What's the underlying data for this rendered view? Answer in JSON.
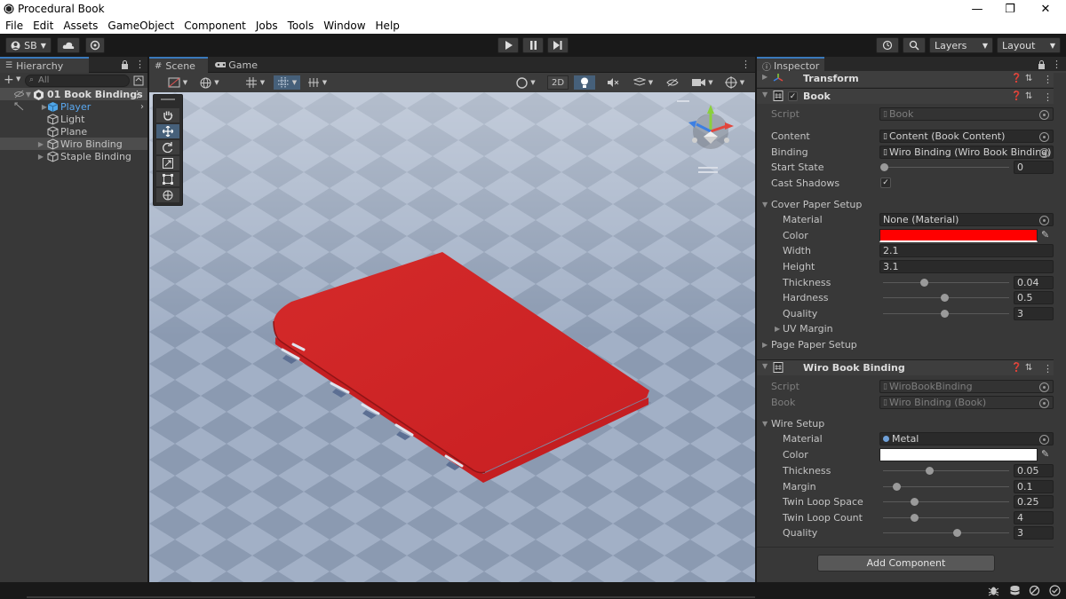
{
  "window": {
    "title": "Procedural Book",
    "min": "—",
    "max": "❐",
    "close": "✕"
  },
  "menu": [
    "File",
    "Edit",
    "Assets",
    "GameObject",
    "Component",
    "Jobs",
    "Tools",
    "Window",
    "Help"
  ],
  "toolbar": {
    "account": "SB",
    "layers": "Layers",
    "layout": "Layout",
    "mode_2d": "2D"
  },
  "hierarchy": {
    "tab": "Hierarchy",
    "search_placeholder": "All",
    "scene": "01 Book Bindings",
    "items": [
      "Player",
      "Light",
      "Plane",
      "Wiro Binding",
      "Staple Binding"
    ]
  },
  "scene": {
    "tab_scene": "Scene",
    "tab_game": "Game"
  },
  "inspector": {
    "tab": "Inspector",
    "transform": "Transform",
    "book": {
      "header": "Book",
      "script_label": "Script",
      "script_value": "Book",
      "content_label": "Content",
      "content_value": "Content (Book Content)",
      "binding_label": "Binding",
      "binding_value": "Wiro Binding (Wiro Book Binding)",
      "start_state_label": "Start State",
      "start_state_value": "0",
      "cast_shadows_label": "Cast Shadows",
      "cover_setup": "Cover Paper Setup",
      "material_label": "Material",
      "material_value": "None (Material)",
      "color_label": "Color",
      "color_value": "#ff0000",
      "width_label": "Width",
      "width_value": "2.1",
      "height_label": "Height",
      "height_value": "3.1",
      "thickness_label": "Thickness",
      "thickness_value": "0.04",
      "hardness_label": "Hardness",
      "hardness_value": "0.5",
      "quality_label": "Quality",
      "quality_value": "3",
      "uv_margin": "UV Margin",
      "page_setup": "Page Paper Setup"
    },
    "wiro": {
      "header": "Wiro Book Binding",
      "script_label": "Script",
      "script_value": "WiroBookBinding",
      "book_label": "Book",
      "book_value": "Wiro Binding (Book)",
      "wire_setup": "Wire Setup",
      "material_label": "Material",
      "material_value": "Metal",
      "color_label": "Color",
      "color_value": "#ffffff",
      "thickness_label": "Thickness",
      "thickness_value": "0.05",
      "margin_label": "Margin",
      "margin_value": "0.1",
      "twin_space_label": "Twin Loop Space",
      "twin_space_value": "0.25",
      "twin_count_label": "Twin Loop Count",
      "twin_count_value": "4",
      "quality_label": "Quality",
      "quality_value": "3"
    },
    "add_component": "Add Component"
  }
}
